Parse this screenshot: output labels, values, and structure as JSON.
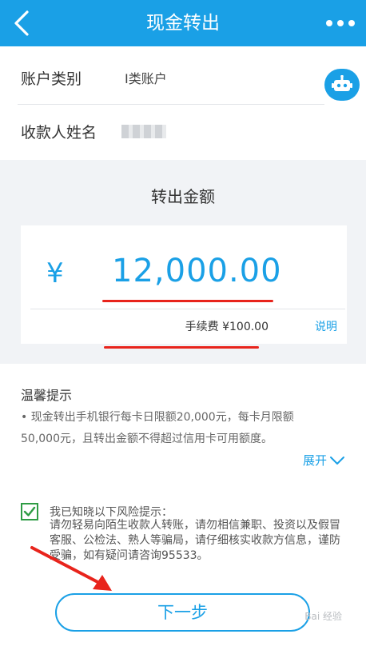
{
  "header": {
    "title": "现金转出",
    "back_icon": "chevron-left-icon",
    "more_icon": "more-dots-icon"
  },
  "account": {
    "type_label": "账户类别",
    "type_value": "I类账户",
    "payee_label": "收款人姓名"
  },
  "amount": {
    "title": "转出金额",
    "currency_symbol": "¥",
    "value": "12,000.00",
    "fee": "手续费 ¥100.00",
    "explain_link": "说明"
  },
  "tips": {
    "title": "温馨提示",
    "text": "• 现金转出手机银行每卡日限额20,000元，每卡月限额50,000元，且转出金额不得超过信用卡可用额度。",
    "expand_label": "展开"
  },
  "risk": {
    "checked": true,
    "heading": "我已知晓以下风险提示：",
    "body": "请勿轻易向陌生收款人转账，请勿相信兼职、投资以及假冒客服、公检法、熟人等骗局，请仔细核实收款方信息，谨防受骗，如有疑问请咨询95533。"
  },
  "footer": {
    "next_button": "下一步",
    "watermark": "Bai 经验"
  },
  "colors": {
    "accent": "#1aa0e6",
    "annotation_red": "#e8241c",
    "check_green": "#2e9c44"
  }
}
